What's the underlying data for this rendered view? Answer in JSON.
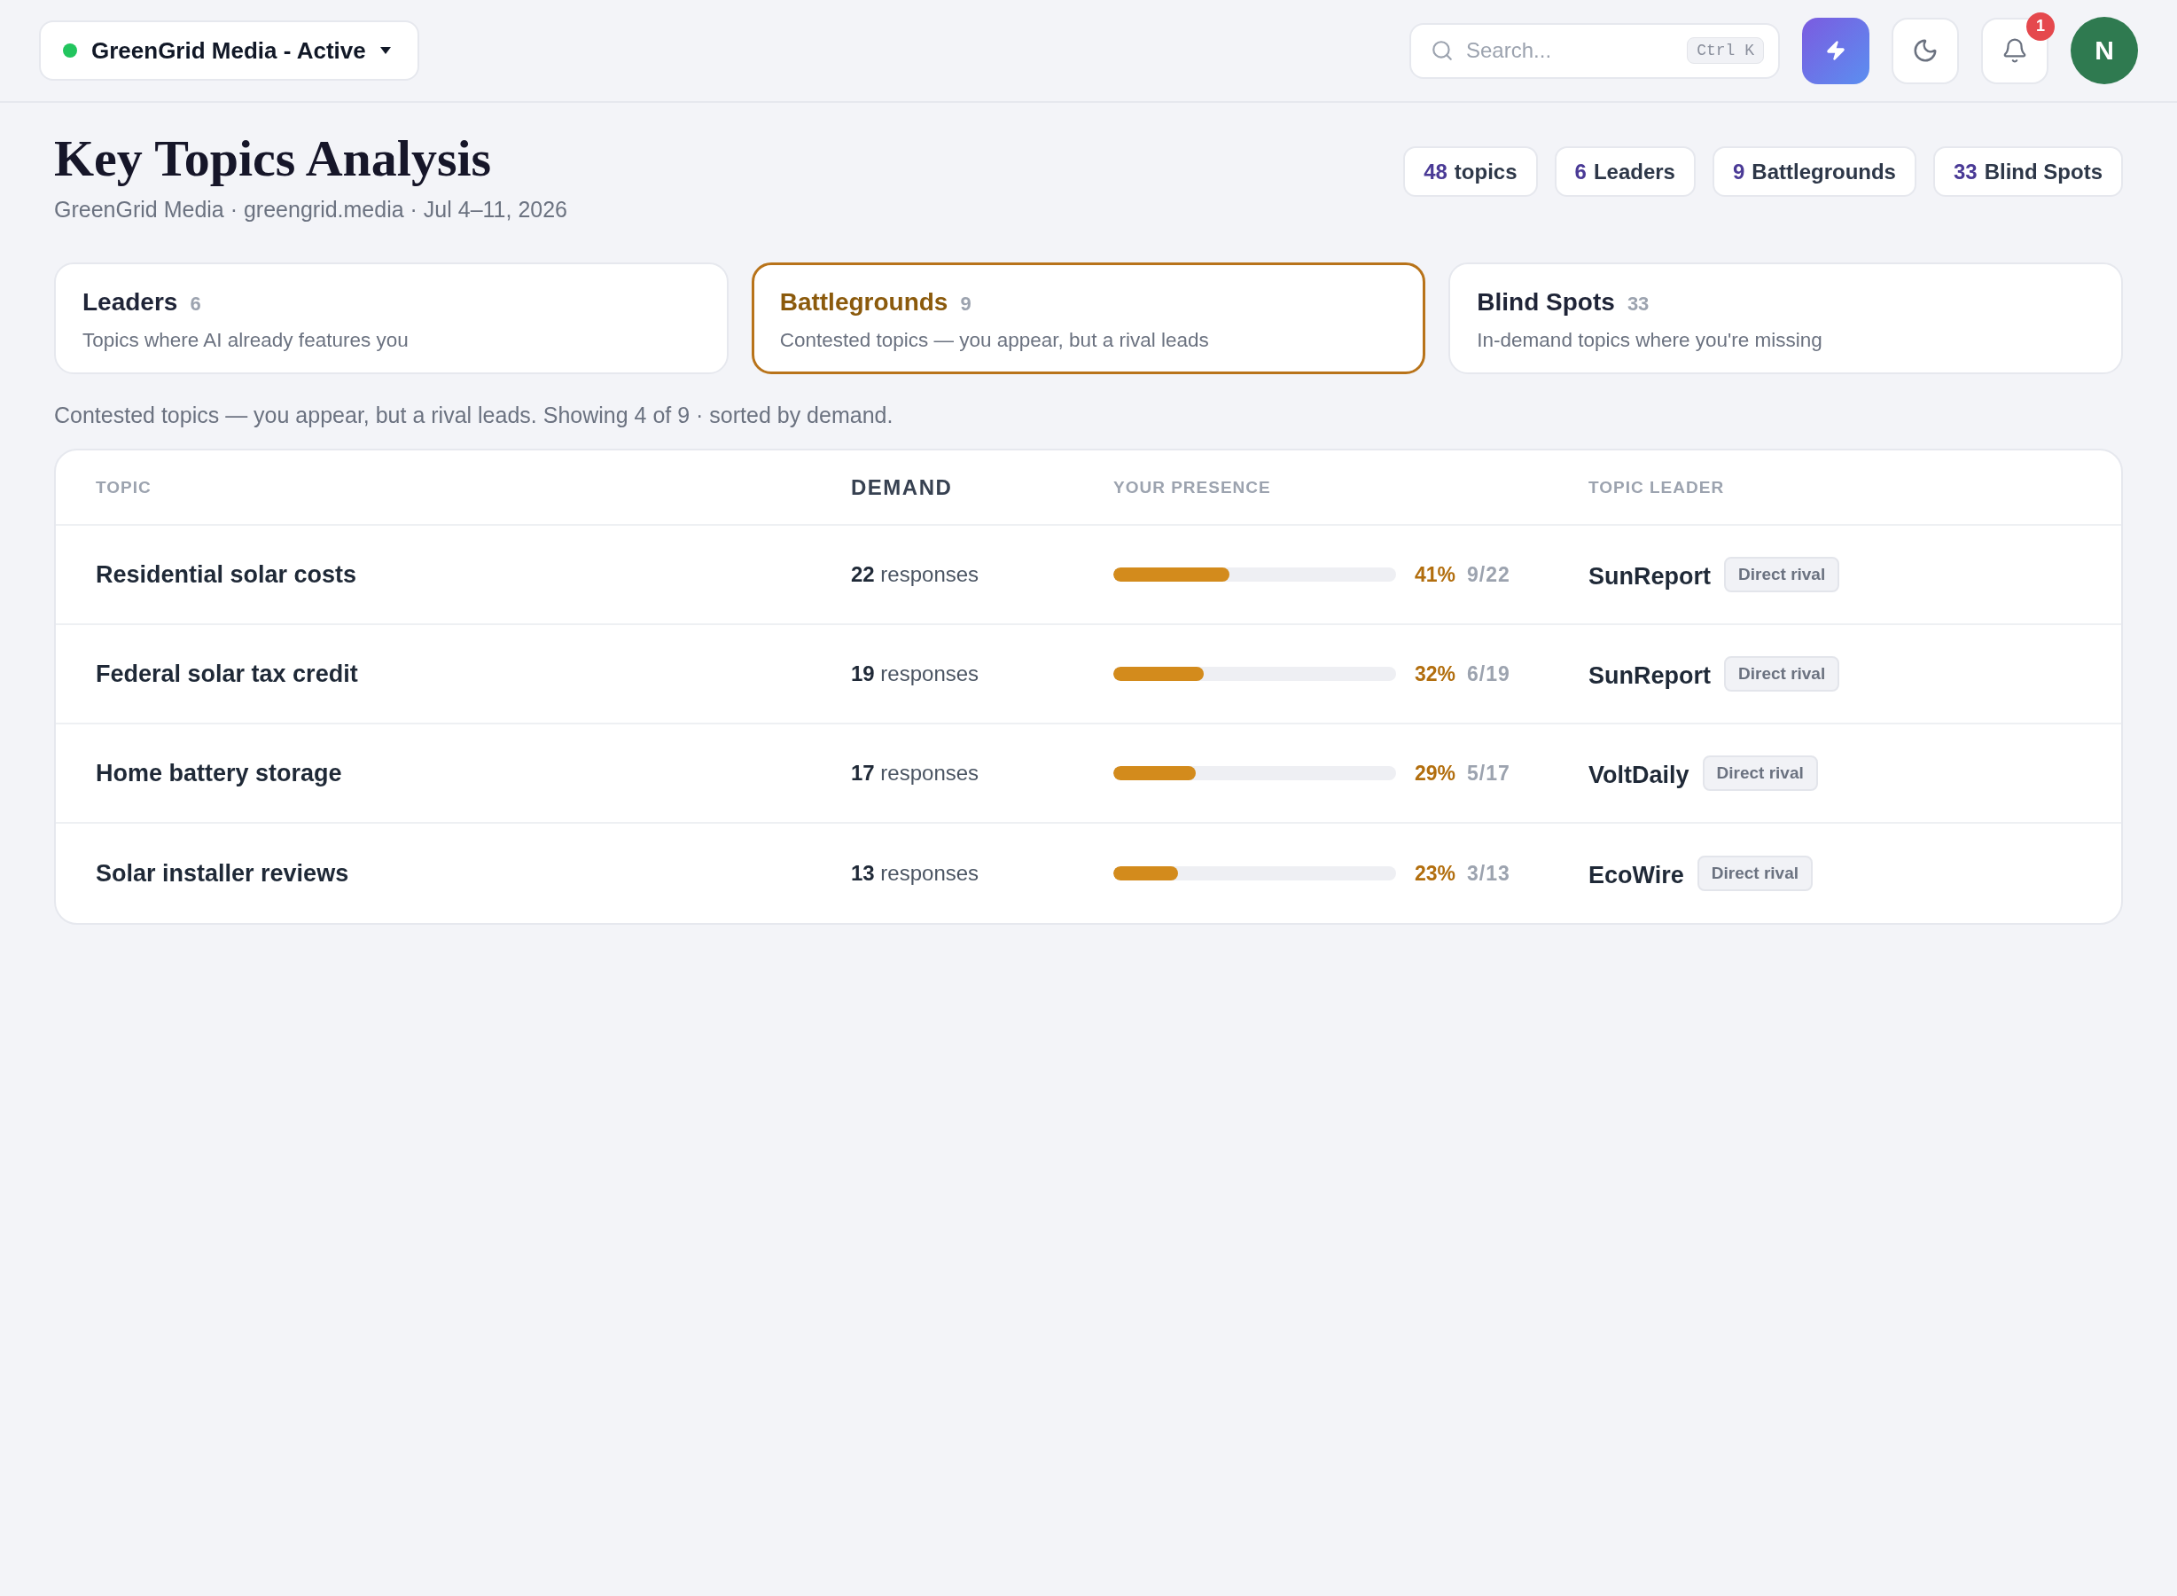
{
  "workspace": {
    "name": "GreenGrid Media - Active"
  },
  "search": {
    "placeholder": "Search...",
    "shortcut": "Ctrl K"
  },
  "notifications": {
    "count": "1"
  },
  "avatar": {
    "initial": "N"
  },
  "page": {
    "title": "Key Topics Analysis",
    "subtitle": "GreenGrid Media · greengrid.media · Jul 4–11, 2026"
  },
  "stats": [
    {
      "value": "48",
      "label": "topics"
    },
    {
      "value": "6",
      "label": "Leaders"
    },
    {
      "value": "9",
      "label": "Battlegrounds"
    },
    {
      "value": "33",
      "label": "Blind Spots"
    }
  ],
  "segments": [
    {
      "title": "Leaders",
      "count": "6",
      "description": "Topics where AI already features you",
      "selected": false
    },
    {
      "title": "Battlegrounds",
      "count": "9",
      "description": "Contested topics — you appear, but a rival leads",
      "selected": true
    },
    {
      "title": "Blind Spots",
      "count": "33",
      "description": "In-demand topics where you're missing",
      "selected": false
    }
  ],
  "caption": "Contested topics — you appear, but a rival leads. Showing 4 of 9 · sorted by demand.",
  "table": {
    "columns": [
      {
        "label": "TOPIC",
        "sorted": false
      },
      {
        "label": "DEMAND",
        "sorted": true
      },
      {
        "label": "YOUR PRESENCE",
        "sorted": false
      },
      {
        "label": "TOPIC LEADER",
        "sorted": false
      }
    ],
    "rows": [
      {
        "topic": "Residential solar costs",
        "demand": "**22** responses",
        "level": 0.41,
        "percent": "41%",
        "ratio": "9/22",
        "leader": "SunReport",
        "leader_tag": "Direct rival"
      },
      {
        "topic": "Federal solar tax credit",
        "demand": "**19** responses",
        "level": 0.32,
        "percent": "32%",
        "ratio": "6/19",
        "leader": "SunReport",
        "leader_tag": "Direct rival"
      },
      {
        "topic": "Home battery storage",
        "demand": "**17** responses",
        "level": 0.29,
        "percent": "29%",
        "ratio": "5/17",
        "leader": "VoltDaily",
        "leader_tag": "Direct rival"
      },
      {
        "topic": "Solar installer reviews",
        "demand": "**13** responses",
        "level": 0.23,
        "percent": "23%",
        "ratio": "3/13",
        "leader": "EcoWire",
        "leader_tag": "Direct rival"
      }
    ]
  }
}
